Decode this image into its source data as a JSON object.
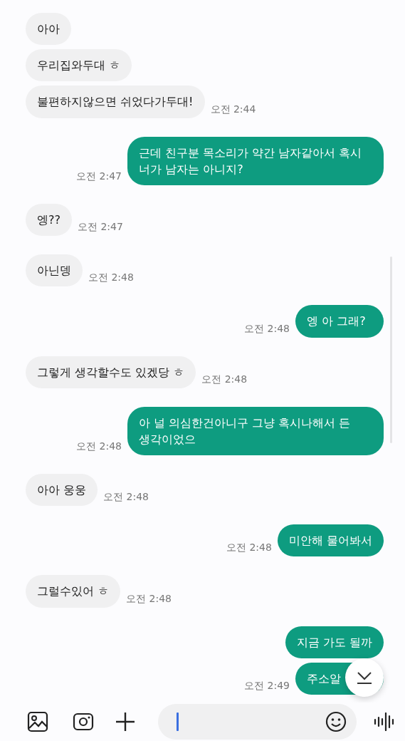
{
  "messages": [
    {
      "kind": "received",
      "text": "아아"
    },
    {
      "kind": "received",
      "text": "우리집와두대 ㅎ"
    },
    {
      "kind": "received",
      "text": "불편하지않으면 쉬었다가두대!",
      "time": "오전 2:44"
    },
    {
      "kind": "sent",
      "text": "근데 친구분 목소리가 약간 남자같아서 혹시 너가 남자는 아니지?",
      "time": "오전 2:47"
    },
    {
      "kind": "received",
      "text": "엥??",
      "time": "오전 2:47"
    },
    {
      "kind": "received",
      "text": "아닌뎅",
      "time": "오전 2:48"
    },
    {
      "kind": "sent",
      "text": "엥 아 그래?",
      "time": "오전 2:48"
    },
    {
      "kind": "received",
      "text": "그렇게 생각할수도 있겠당 ㅎ",
      "time": "오전 2:48"
    },
    {
      "kind": "sent",
      "text": "아 널 의심한건아니구 그냥 혹시나해서 든 생각이었으",
      "time": "오전 2:48"
    },
    {
      "kind": "received",
      "text": "아아 웅웅",
      "time": "오전 2:48"
    },
    {
      "kind": "sent",
      "text": "미안해 물어봐서",
      "time": "오전 2:48"
    },
    {
      "kind": "received",
      "text": "그럴수있어 ㅎ",
      "time": "오전 2:48"
    },
    {
      "kind": "sent",
      "text": "지금 가도 될까"
    },
    {
      "kind": "sent",
      "text": "주소알",
      "time": "오전 2:49"
    }
  ]
}
